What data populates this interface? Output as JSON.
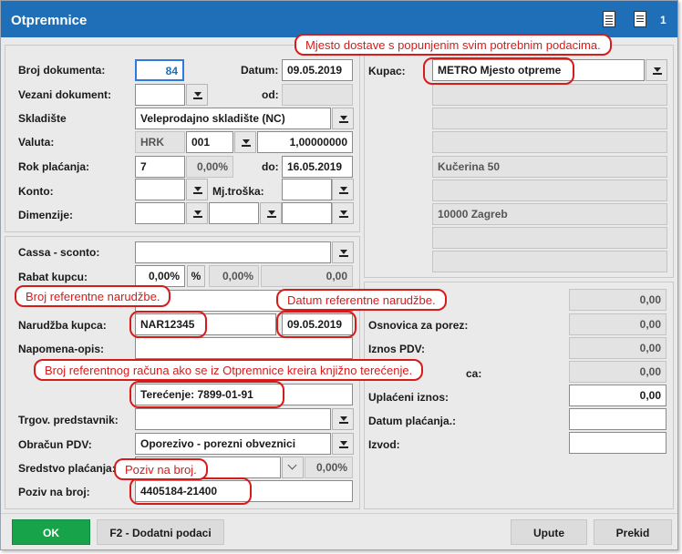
{
  "window": {
    "title": "Otpremnice",
    "toolbar_count": "1"
  },
  "header": {
    "broj_label": "Broj dokumenta:",
    "broj_value": "84",
    "datum_label": "Datum:",
    "datum_value": "09.05.2019",
    "vezani_label": "Vezani dokument:",
    "od_label": "od:",
    "skladiste_label": "Skladište",
    "skladiste_value": "Veleprodajno skladište (NC)",
    "valuta_label": "Valuta:",
    "valuta_code": "HRK",
    "valuta_num": "001",
    "valuta_rate": "1,00000000",
    "rok_label": "Rok plaćanja:",
    "rok_days": "7",
    "rok_pct": "0,00%",
    "do_label": "do:",
    "do_value": "16.05.2019",
    "konto_label": "Konto:",
    "mjtroska_label": "Mj.troška:",
    "dimenzije_label": "Dimenzije:"
  },
  "customer": {
    "kupac_label": "Kupac:",
    "kupac_value": "METRO Mjesto otpreme",
    "address": "Kučerina 50",
    "city": "10000 Zagreb"
  },
  "details": {
    "cassa_label": "Cassa - sconto:",
    "rabat_label": "Rabat kupcu:",
    "rabat_pct": "0,00%",
    "pct_symbol": "%",
    "rabat_pct2": "0,00%",
    "rabat_amount": "0,00",
    "narudzba_label": "Narudžba kupca:",
    "narudzba_value": "NAR12345",
    "narudzba_date": "09.05.2019",
    "napomena_label": "Napomena-opis:",
    "terecenje_value": "Terećenje: 7899-01-91",
    "trgov_label": "Trgov. predstavnik:",
    "obracun_label": "Obračun PDV:",
    "obracun_value": "Oporezivo - porezni obveznici",
    "sredstvo_label": "Sredstvo plaćanja:",
    "sredstvo_pct": "0,00%",
    "poziv_label": "Poziv na broj:",
    "poziv_value": "4405184-21400"
  },
  "totals": {
    "row1_value": "0,00",
    "osnovica_label": "Osnovica za porez:",
    "osnovica_value": "0,00",
    "iznos_pdv_label": "Iznos PDV:",
    "iznos_pdv_value": "0,00",
    "hidden_label_tail": "ca:",
    "hidden_value": "0,00",
    "uplaceni_label": "Uplaćeni iznos:",
    "uplaceni_value": "0,00",
    "datum_placanja_label": "Datum plaćanja.:",
    "izvod_label": "Izvod:"
  },
  "callouts": {
    "mjesto_dostave": "Mjesto dostave s popunjenim svim potrebnim podacima.",
    "broj_ref_narudzbe": "Broj referentne narudžbe.",
    "datum_ref_narudzbe": "Datum referentne narudžbe.",
    "broj_ref_racuna": "Broj referentnog računa ako se iz Otpremnice kreira knjižno terećenje.",
    "poziv_na_broj": "Poziv na broj."
  },
  "footer": {
    "ok_label": "OK",
    "dodatni_label": "F2 - Dodatni podaci",
    "upute_label": "Upute",
    "prekid_label": "Prekid"
  },
  "colors": {
    "titlebar": "#1e6fb8",
    "ok_button": "#16a34a",
    "callout": "#d61b1b",
    "selected_border": "#2d7be0"
  }
}
